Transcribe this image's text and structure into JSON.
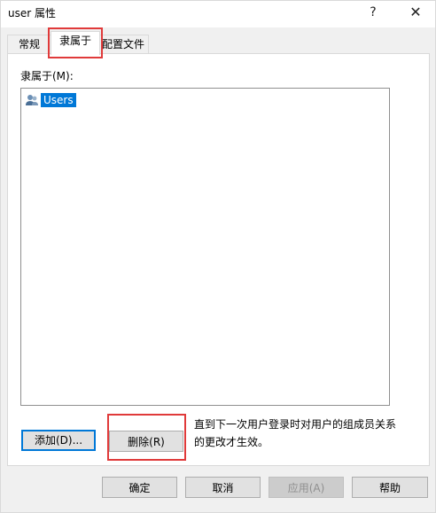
{
  "window": {
    "title": "user 属性",
    "help_glyph": "?",
    "close_glyph": "✕"
  },
  "tabs": [
    {
      "label": "常规",
      "active": false
    },
    {
      "label": "隶属于",
      "active": true
    },
    {
      "label": "配置文件",
      "active": false
    }
  ],
  "member_of": {
    "label": "隶属于(M):",
    "items": [
      {
        "name": "Users",
        "selected": true,
        "icon": "group-icon"
      }
    ],
    "add_button": "添加(D)...",
    "remove_button": "删除(R)",
    "note": "直到下一次用户登录时对用户的组成员关系的更改才生效。"
  },
  "footer": {
    "ok": "确定",
    "cancel": "取消",
    "apply": "应用(A)",
    "help": "帮助"
  },
  "colors": {
    "selection": "#0078d7",
    "highlight_box": "#e03a3a"
  }
}
